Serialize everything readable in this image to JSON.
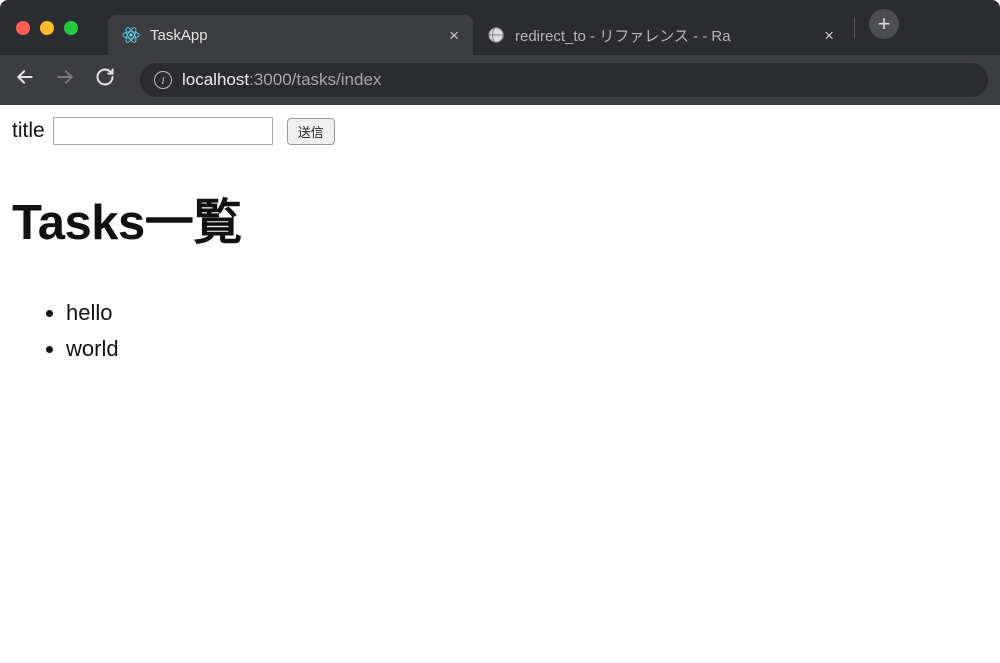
{
  "browser": {
    "tabs": [
      {
        "title": "TaskApp",
        "active": true,
        "favicon": "react-icon"
      },
      {
        "title": "redirect_to - リファレンス - - Ra",
        "active": false,
        "favicon": "globe-icon"
      }
    ],
    "url_host": "localhost",
    "url_rest": ":3000/tasks/index"
  },
  "form": {
    "label": "title",
    "input_value": "",
    "submit_label": "送信"
  },
  "heading": "Tasks一覧",
  "tasks": [
    {
      "title": "hello"
    },
    {
      "title": "world"
    }
  ]
}
